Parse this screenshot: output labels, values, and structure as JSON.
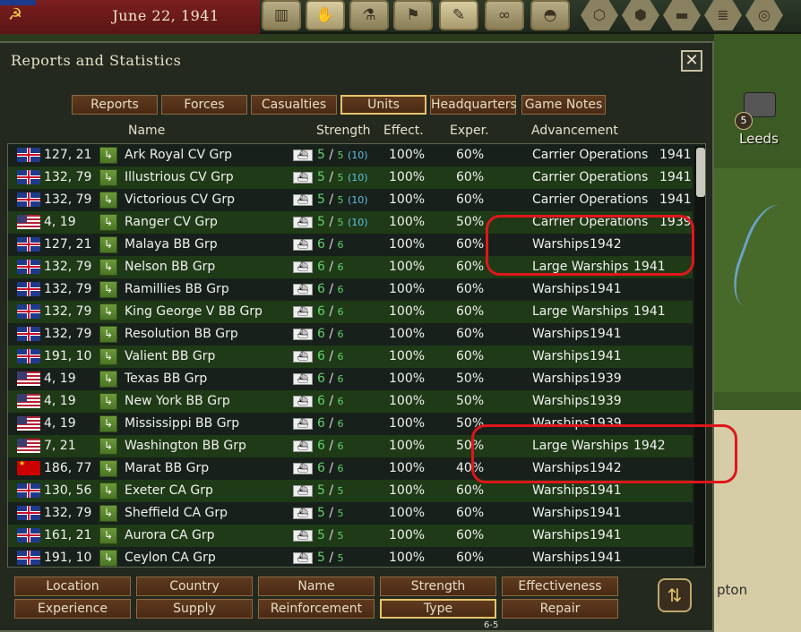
{
  "top_bar": {
    "date": "June 22, 1941",
    "nation_emblem": "hammer-sickle-icon",
    "buttons": [
      {
        "icon": "factory-icon"
      },
      {
        "icon": "hands-icon"
      },
      {
        "icon": "research-microscope-icon"
      },
      {
        "icon": "flag-icon"
      },
      {
        "icon": "reports-notepad-icon"
      },
      {
        "icon": "binoculars-icon"
      },
      {
        "icon": "helmet-icon"
      }
    ],
    "hex_buttons": [
      {
        "icon": "hex-single-icon"
      },
      {
        "icon": "hex-grid-icon"
      },
      {
        "icon": "tank-hex-icon"
      },
      {
        "icon": "stack-hex-icon"
      },
      {
        "icon": "target-hex-icon"
      }
    ]
  },
  "panel": {
    "title": "Reports and Statistics",
    "tabs": [
      "Reports",
      "Forces",
      "Casualties",
      "Units",
      "Headquarters",
      "Game Notes"
    ],
    "active_tab": "Units",
    "columns": {
      "name": "Name",
      "strength": "Strength",
      "effect": "Effect.",
      "exper": "Exper.",
      "advancement": "Advancement"
    },
    "rows": [
      {
        "flag": "uk",
        "coords": "127, 21",
        "name": "Ark Royal CV Grp",
        "str": "5",
        "max": "5",
        "extra": "(10)",
        "eff": "100%",
        "exp": "60%",
        "adv": "Carrier Operations",
        "year": "1941"
      },
      {
        "flag": "uk",
        "coords": "132, 79",
        "name": "Illustrious CV Grp",
        "str": "5",
        "max": "5",
        "extra": "(10)",
        "eff": "100%",
        "exp": "60%",
        "adv": "Carrier Operations",
        "year": "1941"
      },
      {
        "flag": "uk",
        "coords": "132, 79",
        "name": "Victorious CV Grp",
        "str": "5",
        "max": "5",
        "extra": "(10)",
        "eff": "100%",
        "exp": "60%",
        "adv": "Carrier Operations",
        "year": "1941"
      },
      {
        "flag": "us",
        "coords": "4, 19",
        "name": "Ranger CV Grp",
        "str": "5",
        "max": "5",
        "extra": "(10)",
        "eff": "100%",
        "exp": "50%",
        "adv": "Carrier Operations",
        "year": "1939"
      },
      {
        "flag": "uk",
        "coords": "127, 21",
        "name": "Malaya BB Grp",
        "str": "6",
        "max": "6",
        "extra": "",
        "eff": "100%",
        "exp": "60%",
        "adv": "Warships",
        "year": "1942"
      },
      {
        "flag": "uk",
        "coords": "132, 79",
        "name": "Nelson BB Grp",
        "str": "6",
        "max": "6",
        "extra": "",
        "eff": "100%",
        "exp": "60%",
        "adv": "Large Warships",
        "year": "1941"
      },
      {
        "flag": "uk",
        "coords": "132, 79",
        "name": "Ramillies BB Grp",
        "str": "6",
        "max": "6",
        "extra": "",
        "eff": "100%",
        "exp": "60%",
        "adv": "Warships",
        "year": "1941"
      },
      {
        "flag": "uk",
        "coords": "132, 79",
        "name": "King George V BB Grp",
        "str": "6",
        "max": "6",
        "extra": "",
        "eff": "100%",
        "exp": "60%",
        "adv": "Large Warships",
        "year": "1941"
      },
      {
        "flag": "uk",
        "coords": "132, 79",
        "name": "Resolution BB Grp",
        "str": "6",
        "max": "6",
        "extra": "",
        "eff": "100%",
        "exp": "60%",
        "adv": "Warships",
        "year": "1941"
      },
      {
        "flag": "uk",
        "coords": "191, 10",
        "name": "Valient BB Grp",
        "str": "6",
        "max": "6",
        "extra": "",
        "eff": "100%",
        "exp": "60%",
        "adv": "Warships",
        "year": "1941"
      },
      {
        "flag": "us",
        "coords": "4, 19",
        "name": "Texas BB Grp",
        "str": "6",
        "max": "6",
        "extra": "",
        "eff": "100%",
        "exp": "50%",
        "adv": "Warships",
        "year": "1939"
      },
      {
        "flag": "us",
        "coords": "4, 19",
        "name": "New York BB Grp",
        "str": "6",
        "max": "6",
        "extra": "",
        "eff": "100%",
        "exp": "50%",
        "adv": "Warships",
        "year": "1939"
      },
      {
        "flag": "us",
        "coords": "4, 19",
        "name": "Mississippi BB Grp",
        "str": "6",
        "max": "6",
        "extra": "",
        "eff": "100%",
        "exp": "50%",
        "adv": "Warships",
        "year": "1939"
      },
      {
        "flag": "us",
        "coords": "7, 21",
        "name": "Washington BB Grp",
        "str": "6",
        "max": "6",
        "extra": "",
        "eff": "100%",
        "exp": "50%",
        "adv": "Large Warships",
        "year": "1942"
      },
      {
        "flag": "su",
        "coords": "186, 77",
        "name": "Marat BB Grp",
        "str": "6",
        "max": "6",
        "extra": "",
        "eff": "100%",
        "exp": "40%",
        "adv": "Warships",
        "year": "1942"
      },
      {
        "flag": "uk",
        "coords": "130, 56",
        "name": "Exeter CA Grp",
        "str": "5",
        "max": "5",
        "extra": "",
        "eff": "100%",
        "exp": "60%",
        "adv": "Warships",
        "year": "1941"
      },
      {
        "flag": "uk",
        "coords": "132, 79",
        "name": "Sheffield CA Grp",
        "str": "5",
        "max": "5",
        "extra": "",
        "eff": "100%",
        "exp": "60%",
        "adv": "Warships",
        "year": "1941"
      },
      {
        "flag": "uk",
        "coords": "161, 21",
        "name": "Aurora CA Grp",
        "str": "5",
        "max": "5",
        "extra": "",
        "eff": "100%",
        "exp": "60%",
        "adv": "Warships",
        "year": "1941"
      },
      {
        "flag": "uk",
        "coords": "191, 10",
        "name": "Ceylon CA Grp",
        "str": "5",
        "max": "5",
        "extra": "",
        "eff": "100%",
        "exp": "60%",
        "adv": "Warships",
        "year": "1941"
      }
    ],
    "sort_buttons_row1": [
      "Location",
      "Country",
      "Name",
      "Strength",
      "Effectiveness"
    ],
    "sort_buttons_row2": [
      "Experience",
      "Supply",
      "Reinforcement",
      "Type",
      "Repair"
    ],
    "active_sort": "Type",
    "sort_toggle_icon": "sort-arrows-icon"
  },
  "map": {
    "city_name": "Leeds",
    "city_value": "5",
    "partial_label": "pton",
    "partial_label_2": "6-5"
  },
  "colors": {
    "highlight": "#e0161b",
    "accent": "#e5c46b",
    "strength": "#5fd16a"
  }
}
